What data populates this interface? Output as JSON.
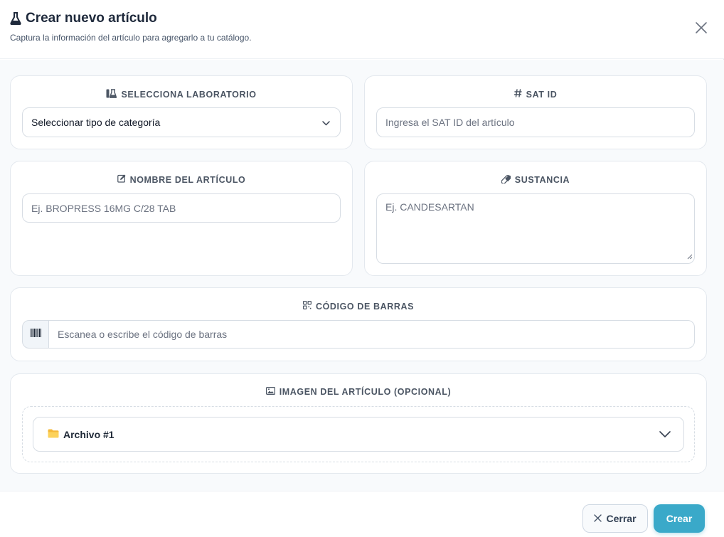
{
  "header": {
    "title": "Crear nuevo artículo",
    "subtitle": "Captura la información del artículo para agregarlo a tu catálogo."
  },
  "laboratorio": {
    "label": "SELECCIONA LABORATORIO",
    "selected": "Seleccionar tipo de categoría"
  },
  "sat_id": {
    "label": "SAT ID",
    "placeholder": "Ingresa el SAT ID del artículo"
  },
  "nombre": {
    "label": "NOMBRE DEL ARTÍCULO",
    "placeholder": "Ej. BROPRESS 16MG C/28 TAB"
  },
  "sustancia": {
    "label": "SUSTANCIA",
    "placeholder": "Ej. CANDESARTAN"
  },
  "codigo_barras": {
    "label": "CÓDIGO DE BARRAS",
    "placeholder": "Escanea o escribe el código de barras"
  },
  "imagen": {
    "label": "IMAGEN DEL ARTÍCULO (OPCIONAL)",
    "files": [
      {
        "name": "Archivo #1"
      }
    ]
  },
  "footer": {
    "cancel_label": "Cerrar",
    "create_label": "Crear"
  },
  "colors": {
    "accent": "#3aa9c9",
    "folder": "#f5b93a"
  },
  "icons": {
    "title": "flask-icon",
    "close": "close-icon",
    "laboratorio": "flask-icon",
    "sat_id": "hash-icon",
    "nombre": "edit-icon",
    "sustancia": "pill-icon",
    "codigo": "qrcode-icon",
    "imagen": "image-icon",
    "barcode": "barcode-icon",
    "folder": "folder-icon",
    "chevron": "chevron-down-icon"
  }
}
